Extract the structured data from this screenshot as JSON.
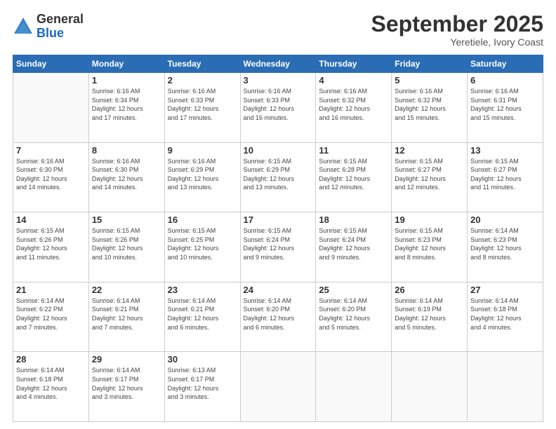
{
  "logo": {
    "general": "General",
    "blue": "Blue"
  },
  "header": {
    "month": "September 2025",
    "location": "Yeretiele, Ivory Coast"
  },
  "weekdays": [
    "Sunday",
    "Monday",
    "Tuesday",
    "Wednesday",
    "Thursday",
    "Friday",
    "Saturday"
  ],
  "weeks": [
    [
      {
        "day": "",
        "info": ""
      },
      {
        "day": "1",
        "info": "Sunrise: 6:16 AM\nSunset: 6:34 PM\nDaylight: 12 hours\nand 17 minutes."
      },
      {
        "day": "2",
        "info": "Sunrise: 6:16 AM\nSunset: 6:33 PM\nDaylight: 12 hours\nand 17 minutes."
      },
      {
        "day": "3",
        "info": "Sunrise: 6:16 AM\nSunset: 6:33 PM\nDaylight: 12 hours\nand 16 minutes."
      },
      {
        "day": "4",
        "info": "Sunrise: 6:16 AM\nSunset: 6:32 PM\nDaylight: 12 hours\nand 16 minutes."
      },
      {
        "day": "5",
        "info": "Sunrise: 6:16 AM\nSunset: 6:32 PM\nDaylight: 12 hours\nand 15 minutes."
      },
      {
        "day": "6",
        "info": "Sunrise: 6:16 AM\nSunset: 6:31 PM\nDaylight: 12 hours\nand 15 minutes."
      }
    ],
    [
      {
        "day": "7",
        "info": "Sunrise: 6:16 AM\nSunset: 6:30 PM\nDaylight: 12 hours\nand 14 minutes."
      },
      {
        "day": "8",
        "info": "Sunrise: 6:16 AM\nSunset: 6:30 PM\nDaylight: 12 hours\nand 14 minutes."
      },
      {
        "day": "9",
        "info": "Sunrise: 6:16 AM\nSunset: 6:29 PM\nDaylight: 12 hours\nand 13 minutes."
      },
      {
        "day": "10",
        "info": "Sunrise: 6:15 AM\nSunset: 6:29 PM\nDaylight: 12 hours\nand 13 minutes."
      },
      {
        "day": "11",
        "info": "Sunrise: 6:15 AM\nSunset: 6:28 PM\nDaylight: 12 hours\nand 12 minutes."
      },
      {
        "day": "12",
        "info": "Sunrise: 6:15 AM\nSunset: 6:27 PM\nDaylight: 12 hours\nand 12 minutes."
      },
      {
        "day": "13",
        "info": "Sunrise: 6:15 AM\nSunset: 6:27 PM\nDaylight: 12 hours\nand 11 minutes."
      }
    ],
    [
      {
        "day": "14",
        "info": "Sunrise: 6:15 AM\nSunset: 6:26 PM\nDaylight: 12 hours\nand 11 minutes."
      },
      {
        "day": "15",
        "info": "Sunrise: 6:15 AM\nSunset: 6:26 PM\nDaylight: 12 hours\nand 10 minutes."
      },
      {
        "day": "16",
        "info": "Sunrise: 6:15 AM\nSunset: 6:25 PM\nDaylight: 12 hours\nand 10 minutes."
      },
      {
        "day": "17",
        "info": "Sunrise: 6:15 AM\nSunset: 6:24 PM\nDaylight: 12 hours\nand 9 minutes."
      },
      {
        "day": "18",
        "info": "Sunrise: 6:15 AM\nSunset: 6:24 PM\nDaylight: 12 hours\nand 9 minutes."
      },
      {
        "day": "19",
        "info": "Sunrise: 6:15 AM\nSunset: 6:23 PM\nDaylight: 12 hours\nand 8 minutes."
      },
      {
        "day": "20",
        "info": "Sunrise: 6:14 AM\nSunset: 6:23 PM\nDaylight: 12 hours\nand 8 minutes."
      }
    ],
    [
      {
        "day": "21",
        "info": "Sunrise: 6:14 AM\nSunset: 6:22 PM\nDaylight: 12 hours\nand 7 minutes."
      },
      {
        "day": "22",
        "info": "Sunrise: 6:14 AM\nSunset: 6:21 PM\nDaylight: 12 hours\nand 7 minutes."
      },
      {
        "day": "23",
        "info": "Sunrise: 6:14 AM\nSunset: 6:21 PM\nDaylight: 12 hours\nand 6 minutes."
      },
      {
        "day": "24",
        "info": "Sunrise: 6:14 AM\nSunset: 6:20 PM\nDaylight: 12 hours\nand 6 minutes."
      },
      {
        "day": "25",
        "info": "Sunrise: 6:14 AM\nSunset: 6:20 PM\nDaylight: 12 hours\nand 5 minutes."
      },
      {
        "day": "26",
        "info": "Sunrise: 6:14 AM\nSunset: 6:19 PM\nDaylight: 12 hours\nand 5 minutes."
      },
      {
        "day": "27",
        "info": "Sunrise: 6:14 AM\nSunset: 6:18 PM\nDaylight: 12 hours\nand 4 minutes."
      }
    ],
    [
      {
        "day": "28",
        "info": "Sunrise: 6:14 AM\nSunset: 6:18 PM\nDaylight: 12 hours\nand 4 minutes."
      },
      {
        "day": "29",
        "info": "Sunrise: 6:14 AM\nSunset: 6:17 PM\nDaylight: 12 hours\nand 3 minutes."
      },
      {
        "day": "30",
        "info": "Sunrise: 6:13 AM\nSunset: 6:17 PM\nDaylight: 12 hours\nand 3 minutes."
      },
      {
        "day": "",
        "info": ""
      },
      {
        "day": "",
        "info": ""
      },
      {
        "day": "",
        "info": ""
      },
      {
        "day": "",
        "info": ""
      }
    ]
  ]
}
